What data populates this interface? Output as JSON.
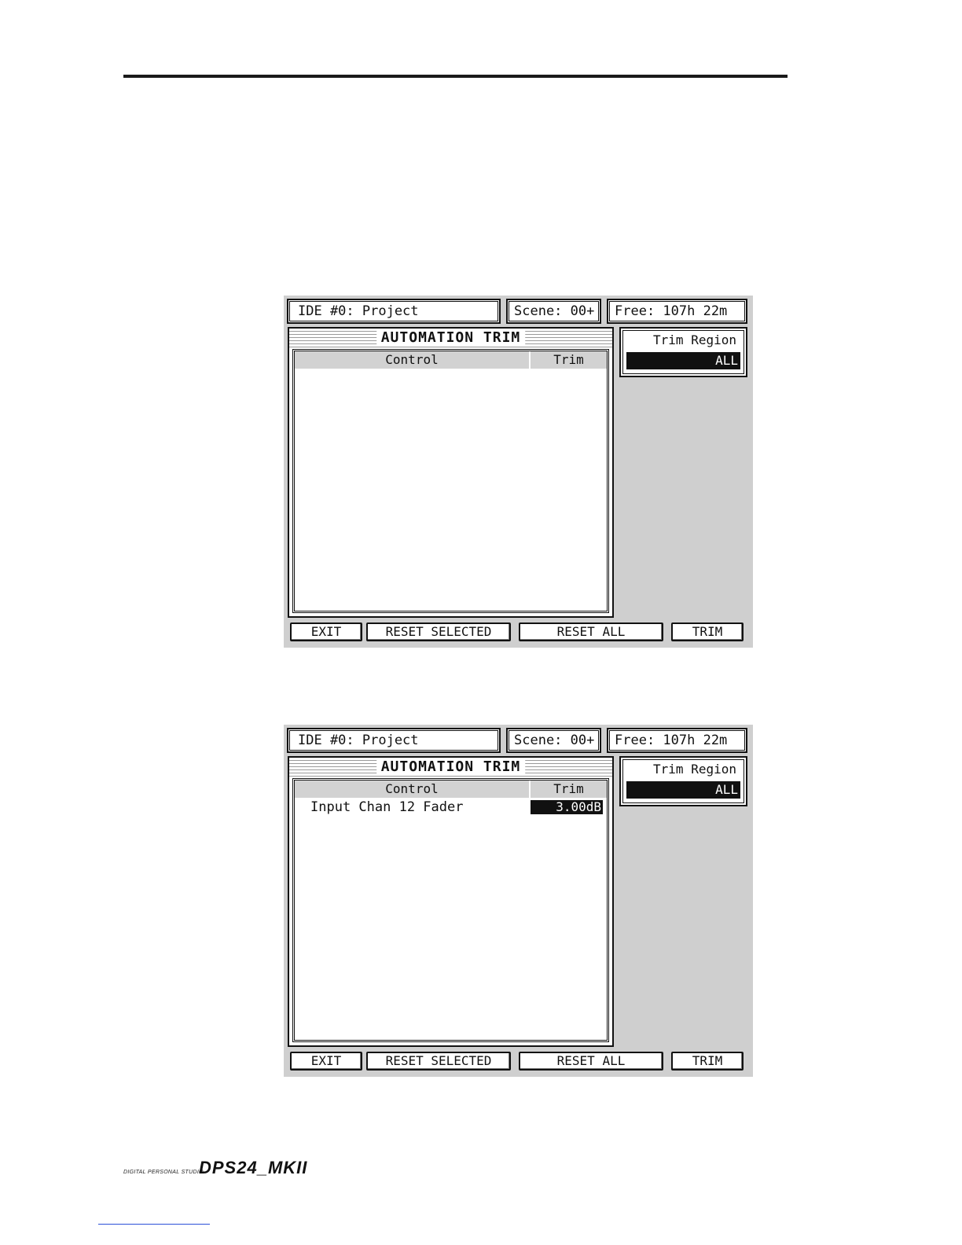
{
  "screens": [
    {
      "header": {
        "project": "IDE #0: Project",
        "scene": "Scene: 00+",
        "free": "Free: 107h 22m"
      },
      "title": "AUTOMATION TRIM",
      "columns": {
        "control": "Control",
        "trim": "Trim"
      },
      "rows": [],
      "trim_region": {
        "label": "Trim Region",
        "value": "ALL"
      },
      "softkeys": {
        "exit": "EXIT",
        "reset_selected": "RESET SELECTED",
        "reset_all": "RESET ALL",
        "trim": "TRIM"
      }
    },
    {
      "header": {
        "project": "IDE #0: Project",
        "scene": "Scene: 00+",
        "free": "Free: 107h 22m"
      },
      "title": "AUTOMATION TRIM",
      "columns": {
        "control": "Control",
        "trim": "Trim"
      },
      "rows": [
        {
          "control": "Input Chan 12 Fader",
          "trim": "3.00dB"
        }
      ],
      "trim_region": {
        "label": "Trim Region",
        "value": "ALL"
      },
      "softkeys": {
        "exit": "EXIT",
        "reset_selected": "RESET SELECTED",
        "reset_all": "RESET ALL",
        "trim": "TRIM"
      }
    }
  ],
  "footer": {
    "brand_small": "DIGITAL PERSONAL STUDIO",
    "brand_logo": "DPS24_MKII"
  }
}
